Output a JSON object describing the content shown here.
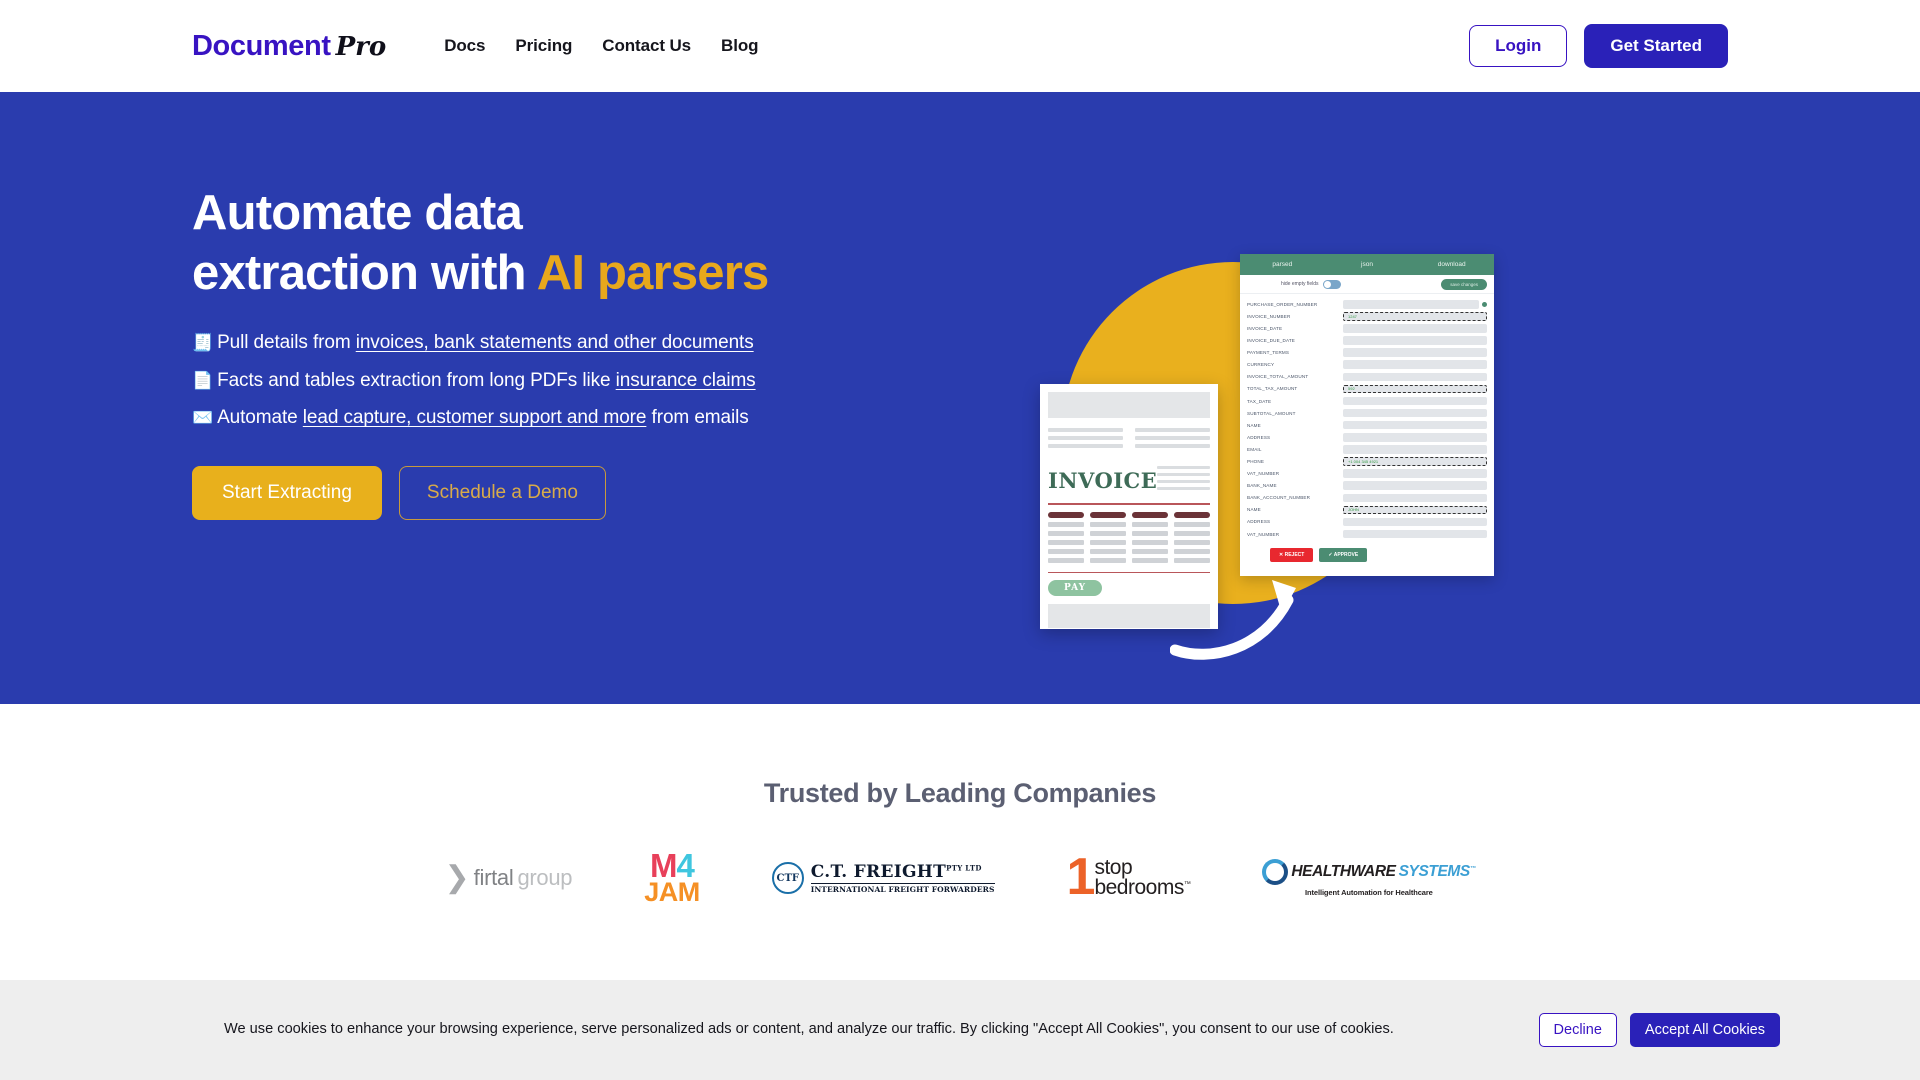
{
  "header": {
    "logo": {
      "main": "Document",
      "script": "Pro"
    },
    "nav": [
      {
        "label": "Docs",
        "name": "nav-link-docs"
      },
      {
        "label": "Pricing",
        "name": "nav-link-pricing"
      },
      {
        "label": "Contact Us",
        "name": "nav-link-contact-us"
      },
      {
        "label": "Blog",
        "name": "nav-link-blog"
      }
    ],
    "login_label": "Login",
    "get_started_label": "Get Started",
    "background": "#ffffff"
  },
  "hero": {
    "background": "#2a3cae",
    "accent_color": "#e8a81c",
    "title_line1": "Automate data",
    "title_line2": "extraction with ",
    "title_accent": "AI parsers",
    "bullets": [
      {
        "icon": "receipt-icon",
        "emoji": "🧾",
        "pre": "Pull details from ",
        "link": "invoices, bank statements and other documents",
        "post": ""
      },
      {
        "icon": "pages-icon",
        "emoji": "📄",
        "pre": "Facts and tables extraction from long PDFs like ",
        "link": "insurance claims",
        "post": ""
      },
      {
        "icon": "envelope-icon",
        "emoji": "✉️",
        "pre": "Automate ",
        "link": "lead capture, customer support and more",
        "post": " from emails"
      }
    ],
    "cta_primary": "Start Extracting",
    "cta_secondary": "Schedule a Demo"
  },
  "hero_art": {
    "circle_color": "#e9b01e",
    "panel": {
      "tabs": [
        "parsed",
        "json",
        "download"
      ],
      "toggle_label": "hide empty fields",
      "save_label": "save changes",
      "fields": [
        {
          "label": "PURCHASE_ORDER_NUMBER",
          "value": "",
          "edit": false,
          "dot": true
        },
        {
          "label": "INVOICE_NUMBER",
          "value": "1247",
          "edit": true,
          "dot": false
        },
        {
          "label": "INVOICE_DATE",
          "value": "",
          "edit": false,
          "dot": false
        },
        {
          "label": "INVOICE_DUE_DATE",
          "value": "",
          "edit": false,
          "dot": false
        },
        {
          "label": "PAYMENT_TERMS",
          "value": "",
          "edit": false,
          "dot": false
        },
        {
          "label": "CURRENCY",
          "value": "",
          "edit": false,
          "dot": false
        },
        {
          "label": "INVOICE_TOTAL_AMOUNT",
          "value": "",
          "edit": false,
          "dot": false
        },
        {
          "label": "TOTAL_TAX_AMOUNT",
          "value": "592",
          "edit": true,
          "dot": false
        },
        {
          "label": "TAX_DATE",
          "value": "",
          "edit": false,
          "dot": false
        },
        {
          "label": "SUBTOTAL_AMOUNT",
          "value": "",
          "edit": false,
          "dot": false
        },
        {
          "label": "NAME",
          "value": "",
          "edit": false,
          "dot": false
        },
        {
          "label": "ADDRESS",
          "value": "",
          "edit": false,
          "dot": false
        },
        {
          "label": "EMAIL",
          "value": "",
          "edit": false,
          "dot": false
        },
        {
          "label": "PHONE",
          "value": "+1 004 345 4921",
          "edit": true,
          "dot": false
        },
        {
          "label": "VAT_NUMBER",
          "value": "",
          "edit": false,
          "dot": false
        },
        {
          "label": "BANK_NAME",
          "value": "",
          "edit": false,
          "dot": false
        },
        {
          "label": "BANK_ACCOUNT_NUMBER",
          "value": "",
          "edit": false,
          "dot": false
        },
        {
          "label": "NAME",
          "value": "JOHN",
          "edit": true,
          "dot": false
        },
        {
          "label": "ADDRESS",
          "value": "",
          "edit": false,
          "dot": false
        },
        {
          "label": "VAT_NUMBER",
          "value": "",
          "edit": false,
          "dot": false
        }
      ],
      "reject_label": "REJECT",
      "approve_label": "APPROVE"
    },
    "document": {
      "title": "INVOICE",
      "pay_label": "PAY"
    }
  },
  "trusted": {
    "title": "Trusted by Leading Companies",
    "brands": [
      {
        "name": "firtalgroup",
        "part1": "firtal",
        "part2": "group"
      },
      {
        "name": "m4jam",
        "m": "M",
        "four": "4",
        "jam": "JAM"
      },
      {
        "name": "ct-freight",
        "badge": "CTF",
        "title": "C.T. FREIGHT",
        "suffix": "PTY LTD",
        "tagline": "INTERNATIONAL FREIGHT FORWARDERS"
      },
      {
        "name": "1stop-bedrooms",
        "numeral": "1",
        "line1": "stop",
        "line2": "bedrooms",
        "tm": "™"
      },
      {
        "name": "healthware-systems",
        "part1": "HEALTHWARE",
        "part2": "SYSTEMS",
        "tm": "™",
        "tagline": "Intelligent Automation for Healthcare"
      }
    ]
  },
  "cookie": {
    "text": "We use cookies to enhance your browsing experience, serve personalized ads or content, and analyze our traffic. By clicking \"Accept All Cookies\", you consent to our use of cookies.",
    "decline_label": "Decline",
    "accept_label": "Accept All Cookies"
  }
}
